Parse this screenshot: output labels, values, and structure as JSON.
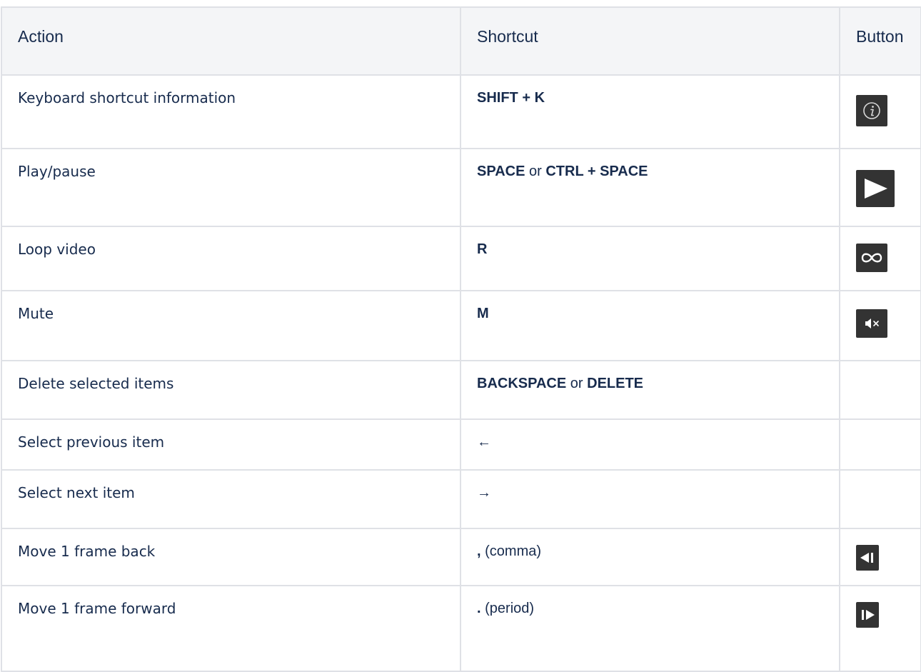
{
  "table": {
    "headers": {
      "action": "Action",
      "shortcut": "Shortcut",
      "button": "Button"
    },
    "rows": [
      {
        "action": "Keyboard shortcut information",
        "keys": [
          "SHIFT + K"
        ],
        "separator": "",
        "button_icon": "info-icon"
      },
      {
        "action": "Play/pause",
        "keys": [
          "SPACE",
          "CTRL + SPACE"
        ],
        "separator": "or",
        "button_icon": "play-icon"
      },
      {
        "action": "Loop video",
        "keys": [
          "R"
        ],
        "separator": "",
        "button_icon": "loop-icon"
      },
      {
        "action": "Mute",
        "keys": [
          "M"
        ],
        "separator": "",
        "button_icon": "mute-icon"
      },
      {
        "action": "Delete selected items",
        "keys": [
          "BACKSPACE",
          "DELETE"
        ],
        "separator": "or",
        "button_icon": ""
      },
      {
        "action": "Select previous item",
        "keys": [
          "←"
        ],
        "separator": "",
        "button_icon": ""
      },
      {
        "action": "Select next item",
        "keys": [
          "→"
        ],
        "separator": "",
        "button_icon": ""
      },
      {
        "action": "Move 1 frame back",
        "keys": [
          ","
        ],
        "separator": "",
        "key_note": "(comma)",
        "button_icon": "frame-back-icon"
      },
      {
        "action": "Move 1 frame forward",
        "keys": [
          "."
        ],
        "separator": "",
        "key_note": "(period)",
        "button_icon": "frame-forward-icon"
      }
    ]
  },
  "colors": {
    "header_bg": "#f4f5f7",
    "border": "#dfe1e6",
    "text": "#172b4d",
    "button_bg": "#333333"
  }
}
